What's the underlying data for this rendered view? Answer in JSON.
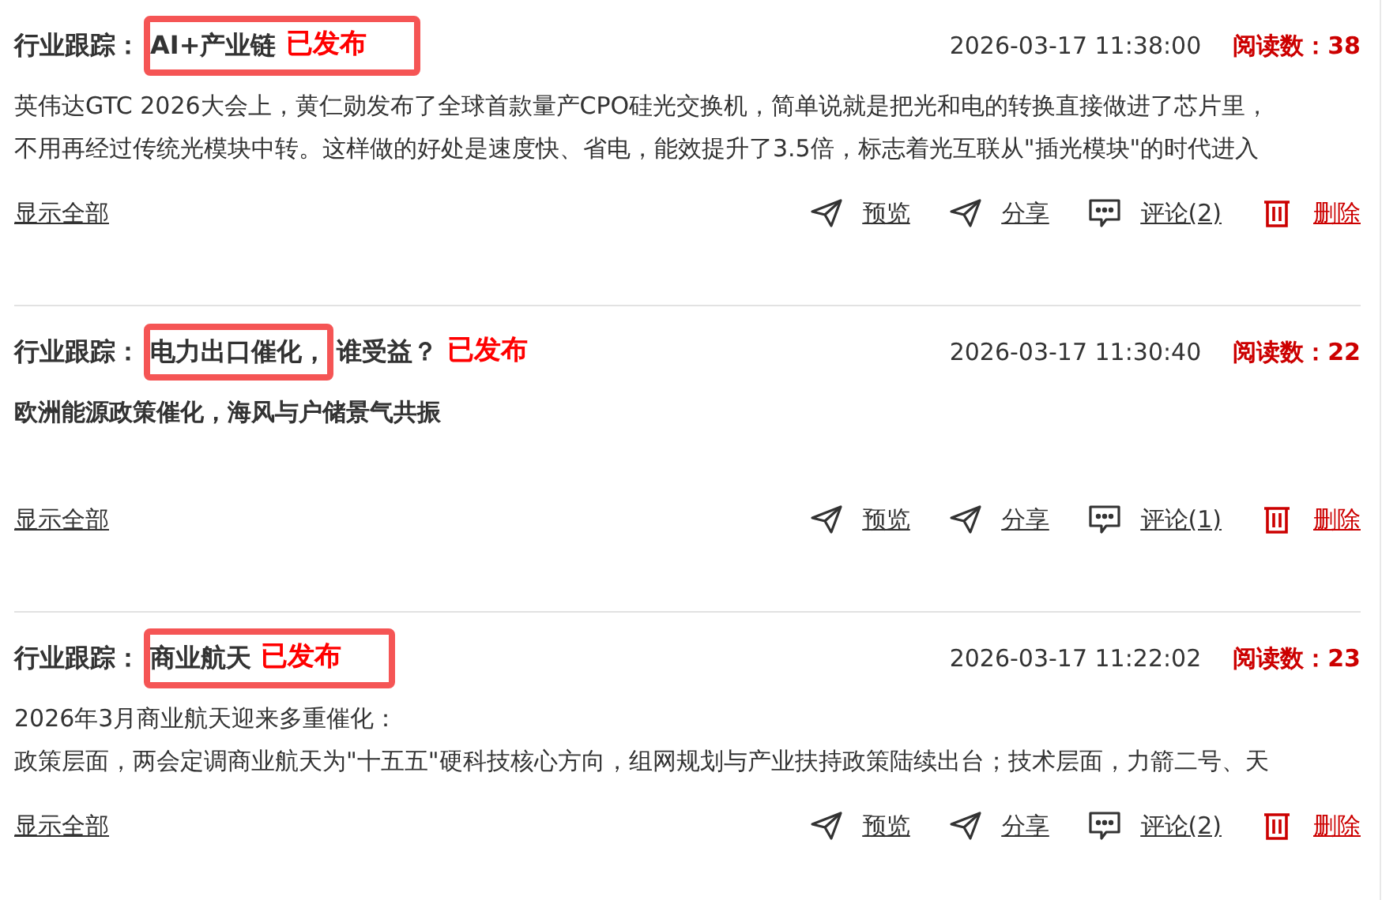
{
  "posts": [
    {
      "title_parts": [
        {
          "text": "行业跟踪：",
          "kind": "plain",
          "boxed": false
        },
        {
          "text": "AI+产业链",
          "kind": "plain",
          "boxed": true
        },
        {
          "text": "已发布",
          "kind": "status",
          "boxed": true
        }
      ],
      "time": "2026-03-17 11:38:00",
      "reads_label": "阅读数：",
      "reads": "38",
      "body_bold": false,
      "body": [
        "英伟达GTC 2026大会上，黄仁勋发布了全球首款量产CPO硅光交换机，简单说就是把光和电的转换直接做进了芯片里，",
        "不用再经过传统光模块中转。这样做的好处是速度快、省电，能效提升了3.5倍，标志着光互联从\"插光模块\"的时代进入"
      ],
      "show_all": "显示全部",
      "actions": [
        {
          "kind": "send",
          "label": "预览"
        },
        {
          "kind": "send",
          "label": "分享"
        },
        {
          "kind": "comment",
          "label": "评论(2)"
        },
        {
          "kind": "delete",
          "label": "删除"
        }
      ]
    },
    {
      "title_parts": [
        {
          "text": "行业跟踪：",
          "kind": "plain",
          "boxed": false
        },
        {
          "text": "电力出口催化，",
          "kind": "plain",
          "boxed": true
        },
        {
          "text": "谁受益？",
          "kind": "plain",
          "boxed": false
        },
        {
          "text": "已发布",
          "kind": "status",
          "boxed": false
        }
      ],
      "time": "2026-03-17 11:30:40",
      "reads_label": "阅读数：",
      "reads": "22",
      "body_bold": true,
      "body": [
        "欧洲能源政策催化，海风与户储景气共振"
      ],
      "show_all": "显示全部",
      "actions": [
        {
          "kind": "send",
          "label": "预览"
        },
        {
          "kind": "send",
          "label": "分享"
        },
        {
          "kind": "comment",
          "label": "评论(1)"
        },
        {
          "kind": "delete",
          "label": "删除"
        }
      ]
    },
    {
      "title_parts": [
        {
          "text": "行业跟踪：",
          "kind": "plain",
          "boxed": false
        },
        {
          "text": "商业航天",
          "kind": "plain",
          "boxed": true
        },
        {
          "text": "已发布",
          "kind": "status",
          "boxed": true
        }
      ],
      "time": "2026-03-17 11:22:02",
      "reads_label": "阅读数：",
      "reads": "23",
      "body_bold": false,
      "body": [
        "2026年3月商业航天迎来多重催化：",
        "政策层面，两会定调商业航天为\"十五五\"硬科技核心方向，组网规划与产业扶持政策陆续出台；技术层面，力箭二号、天"
      ],
      "show_all": "显示全部",
      "actions": [
        {
          "kind": "send",
          "label": "预览"
        },
        {
          "kind": "send",
          "label": "分享"
        },
        {
          "kind": "comment",
          "label": "评论(2)"
        },
        {
          "kind": "delete",
          "label": "删除"
        }
      ]
    }
  ]
}
